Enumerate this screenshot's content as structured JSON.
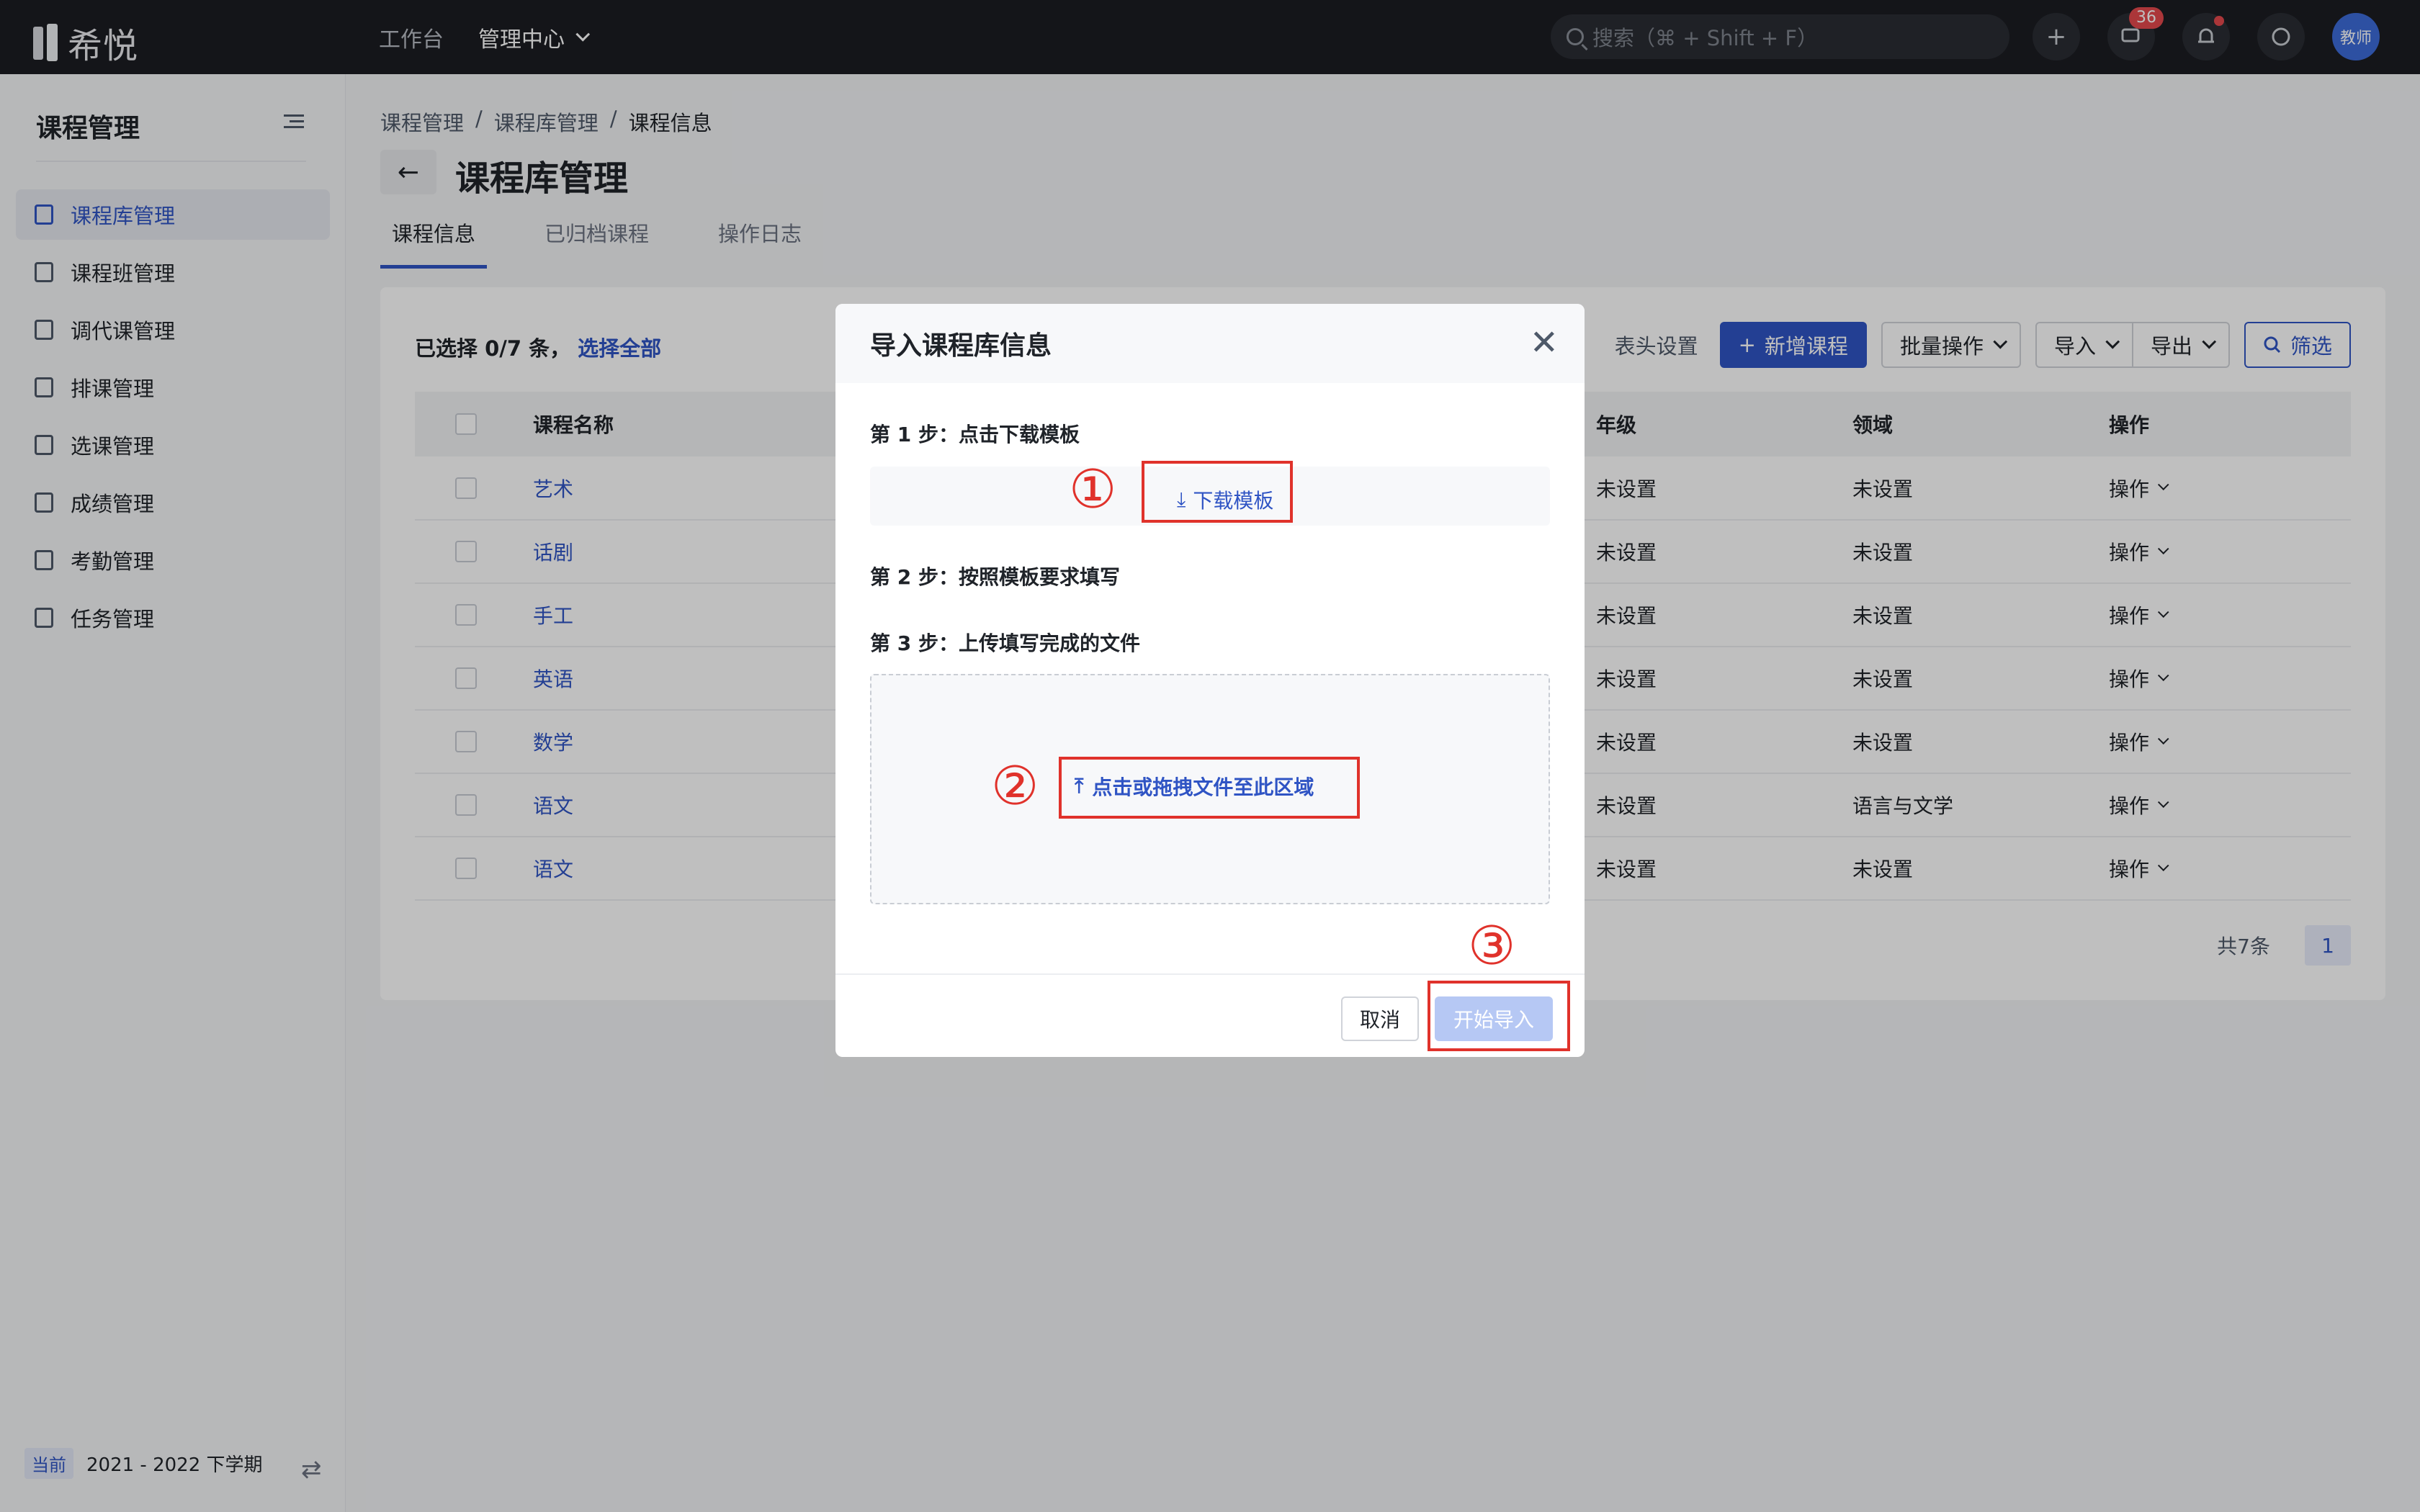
{
  "app": {
    "logo_text": "希悦"
  },
  "topnav": {
    "items": [
      "工作台"
    ],
    "active": "管理中心"
  },
  "search": {
    "placeholder": "搜索（⌘ + Shift + F）"
  },
  "top_icons": {
    "message_badge": "36",
    "avatar_text": "教师"
  },
  "sidebar": {
    "title": "课程管理",
    "items": [
      {
        "label": "课程库管理",
        "icon": "list-icon",
        "active": true
      },
      {
        "label": "课程班管理",
        "icon": "class-icon"
      },
      {
        "label": "调代课管理",
        "icon": "swap-class-icon"
      },
      {
        "label": "排课管理",
        "icon": "schedule-icon"
      },
      {
        "label": "选课管理",
        "icon": "select-course-icon"
      },
      {
        "label": "成绩管理",
        "icon": "score-icon"
      },
      {
        "label": "考勤管理",
        "icon": "attendance-icon"
      },
      {
        "label": "任务管理",
        "icon": "task-icon"
      }
    ],
    "footer": {
      "tag": "当前",
      "term": "2021 - 2022 下学期"
    }
  },
  "breadcrumb": [
    "课程管理",
    "/",
    "课程库管理",
    "/",
    "课程信息"
  ],
  "page": {
    "title": "课程库管理"
  },
  "tabs": [
    "课程信息",
    "已归档课程",
    "操作日志"
  ],
  "toolbar": {
    "selection": "已选择 0/7 条，",
    "select_all": "选择全部",
    "header_setting": "表头设置",
    "add": "新增课程",
    "batch": "批量操作",
    "import": "导入",
    "export": "导出",
    "filter": "筛选"
  },
  "table": {
    "headers": {
      "name": "课程名称",
      "grade": "年级",
      "domain": "领域",
      "op": "操作"
    },
    "rows": [
      {
        "name": "艺术",
        "grade": "未设置",
        "domain": "未设置",
        "op": "操作"
      },
      {
        "name": "话剧",
        "grade": "未设置",
        "domain": "未设置",
        "op": "操作"
      },
      {
        "name": "手工",
        "grade": "未设置",
        "domain": "未设置",
        "op": "操作"
      },
      {
        "name": "英语",
        "grade": "未设置",
        "domain": "未设置",
        "op": "操作"
      },
      {
        "name": "数学",
        "grade": "未设置",
        "domain": "未设置",
        "op": "操作"
      },
      {
        "name": "语文",
        "grade": "未设置",
        "domain": "语言与文学",
        "op": "操作"
      },
      {
        "name": "语文",
        "grade": "未设置",
        "domain": "未设置",
        "op": "操作"
      }
    ]
  },
  "pager": {
    "total": "共7条",
    "current": "1"
  },
  "modal": {
    "title": "导入课程库信息",
    "step1": "第 1 步：点击下载模板",
    "download": "下载模板",
    "step2": "第 2 步：按照模板要求填写",
    "step3": "第 3 步：上传填写完成的文件",
    "upload": "点击或拖拽文件至此区域",
    "cancel": "取消",
    "start": "开始导入"
  },
  "annotations": [
    "①",
    "②",
    "③"
  ],
  "colors": {
    "accent": "#2f54c4",
    "annotation": "#e0322b",
    "topbar": "#1b1d22"
  }
}
